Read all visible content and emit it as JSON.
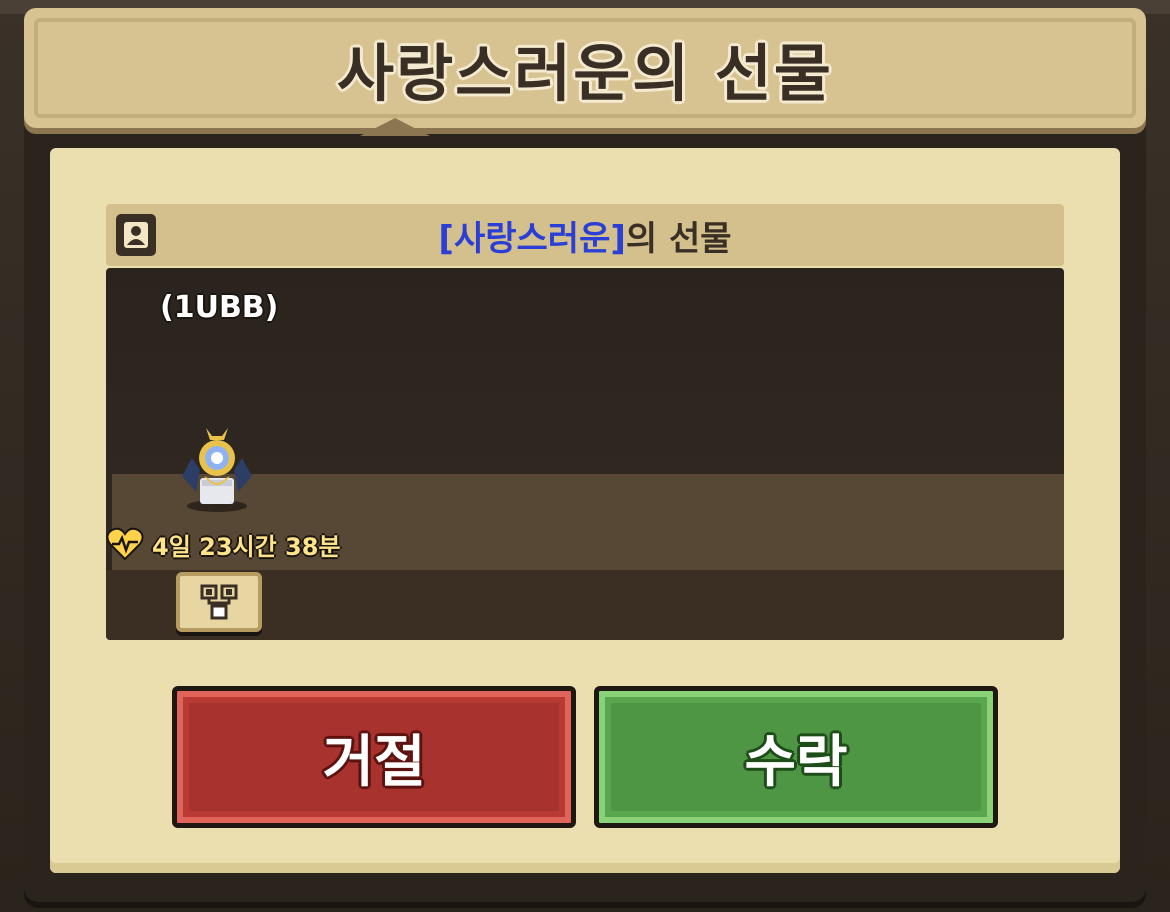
{
  "dialog": {
    "title": "사랑스러운의 선물"
  },
  "sender": {
    "name": "[사랑스러운]",
    "suffix": "의 선물",
    "icon": "profile-icon"
  },
  "gift": {
    "pet_name": "(1UBB)",
    "timer": "4일 23시간 38분",
    "timer_icon": "heart-pulse-icon",
    "item_icon": "gift-item-icon"
  },
  "buttons": {
    "reject_label": "거절",
    "accept_label": "수락"
  },
  "colors": {
    "sender_name": "#2b3fd6",
    "reject": "#a8322e",
    "accept": "#4e9644",
    "parchment": "#ebdfb0"
  }
}
